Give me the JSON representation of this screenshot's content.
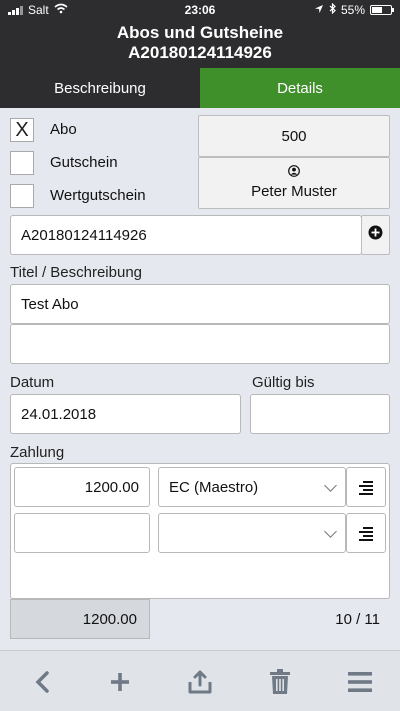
{
  "status": {
    "carrier": "Salt",
    "time": "23:06",
    "battery": "55%"
  },
  "header": {
    "title_line1": "Abos und Gutsheine",
    "title_line2": "A20180124114926"
  },
  "tabs": [
    {
      "label": "Beschreibung"
    },
    {
      "label": "Details"
    }
  ],
  "options": [
    {
      "label": "Abo",
      "checked": true,
      "mark": "X"
    },
    {
      "label": "Gutschein",
      "checked": false
    },
    {
      "label": "Wertgutschein",
      "checked": false
    }
  ],
  "amount_button": {
    "value": "500"
  },
  "person_button": {
    "name": "Peter Muster",
    "icon": "person-icon"
  },
  "code_field": {
    "value": "A20180124114926",
    "add_icon": "plus-circle-icon"
  },
  "title_section": {
    "label": "Titel / Beschreibung",
    "title_value": "Test Abo",
    "description_value": ""
  },
  "dates": {
    "datum_label": "Datum",
    "datum_value": "24.01.2018",
    "gueltig_label": "Gültig bis",
    "gueltig_value": ""
  },
  "payment": {
    "label": "Zahlung",
    "rows": [
      {
        "amount": "1200.00",
        "method": "EC (Maestro)"
      },
      {
        "amount": "",
        "method": ""
      }
    ],
    "total": "1200.00",
    "page": "10 / 11"
  },
  "toolbar": [
    "back-icon",
    "add-icon",
    "share-icon",
    "trash-icon",
    "menu-icon"
  ],
  "colors": {
    "header": "#2d2d2f",
    "accent_tab": "#3f8f2b",
    "background": "#e5e9ef"
  }
}
